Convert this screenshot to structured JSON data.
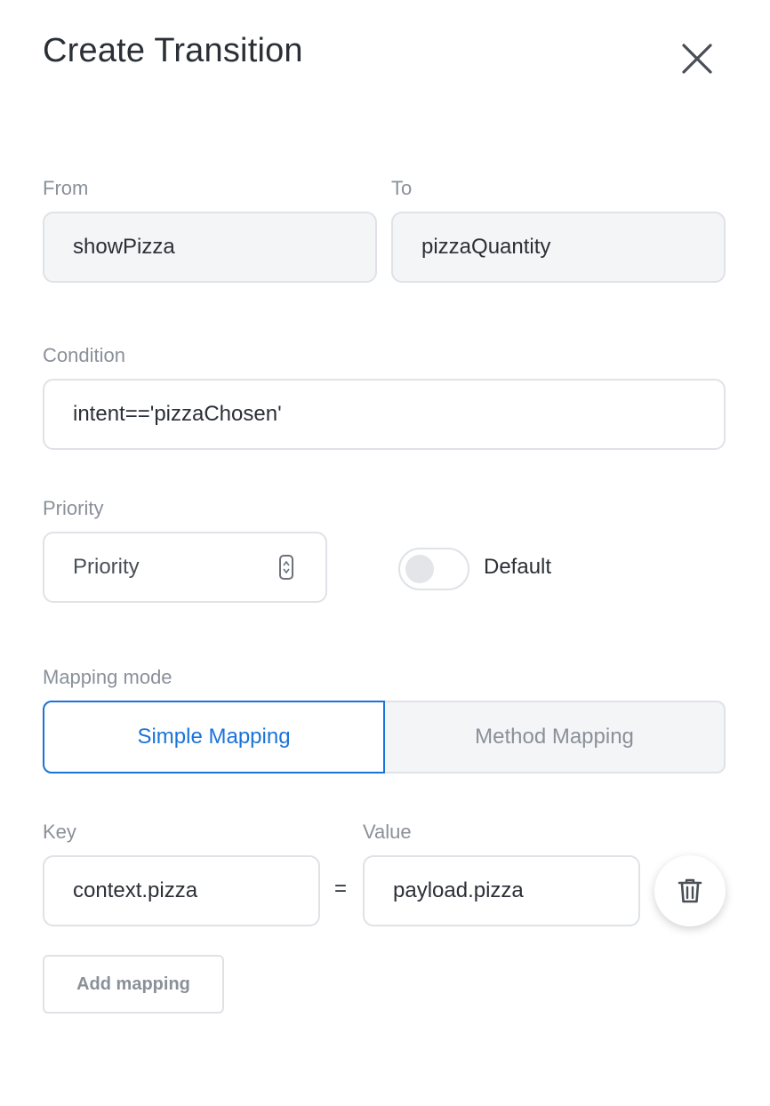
{
  "dialog": {
    "title": "Create Transition"
  },
  "form": {
    "from": {
      "label": "From",
      "value": "showPizza"
    },
    "to": {
      "label": "To",
      "value": "pizzaQuantity"
    },
    "condition": {
      "label": "Condition",
      "value": "intent=='pizzaChosen'"
    },
    "priority": {
      "label": "Priority",
      "placeholder": "Priority"
    },
    "default_toggle": {
      "label": "Default",
      "checked": false
    },
    "mapping_mode": {
      "label": "Mapping mode",
      "options": [
        "Simple Mapping",
        "Method Mapping"
      ],
      "selected": "Simple Mapping"
    },
    "mapping": {
      "key_label": "Key",
      "value_label": "Value",
      "rows": [
        {
          "key": "context.pizza",
          "operator": "=",
          "value": "payload.pizza"
        }
      ],
      "add_label": "Add mapping"
    }
  },
  "colors": {
    "accent": "#1a73d9",
    "label": "#8a9099",
    "text": "#2b2f36",
    "border": "#dfe2e6",
    "readonly_bg": "#f4f5f7"
  },
  "icons": {
    "close": "close-icon",
    "trash": "trash-icon",
    "spinner": "spinner-arrows-icon"
  }
}
